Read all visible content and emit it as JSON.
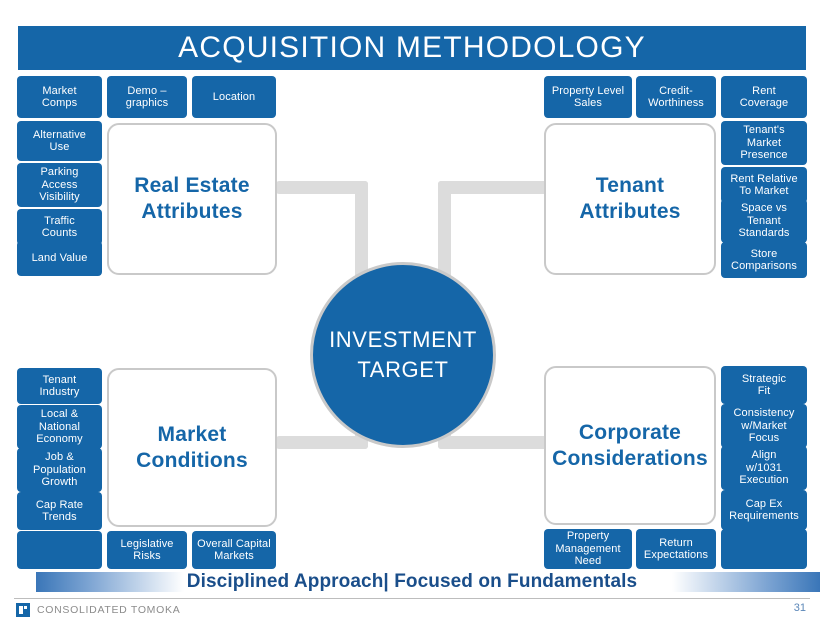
{
  "slide": {
    "title": "ACQUISITION METHODOLOGY",
    "tagline": "Disciplined Approach|  Focused on Fundamentals",
    "page_number": "31",
    "center": {
      "line1": "INVESTMENT",
      "line2": "TARGET"
    }
  },
  "colors": {
    "brand_blue": "#1566A8",
    "hub_border": "#c9c9c9",
    "connector_gray": "#dcdcdc",
    "tagline_blue": "#1A4E8A",
    "footer_gray": "#8c8c8c"
  },
  "quadrants": {
    "real_estate": {
      "hub_line1": "Real Estate",
      "hub_line2": "Attributes",
      "top_chips": [
        {
          "line1": "Market",
          "line2": "Comps"
        },
        {
          "line1": "Demo –",
          "line2": "graphics"
        },
        {
          "line1": "Location",
          "line2": ""
        }
      ],
      "side_chips": [
        {
          "line1": "Alternative",
          "line2": "Use",
          "line3": ""
        },
        {
          "line1": "Parking",
          "line2": "Access",
          "line3": "Visibility"
        },
        {
          "line1": "Traffic",
          "line2": "Counts",
          "line3": ""
        },
        {
          "line1": "Land Value",
          "line2": "",
          "line3": ""
        }
      ]
    },
    "tenant": {
      "hub_line1": "Tenant",
      "hub_line2": "Attributes",
      "top_chips": [
        {
          "line1": "Property Level",
          "line2": "Sales"
        },
        {
          "line1": "Credit-",
          "line2": "Worthiness"
        },
        {
          "line1": "Rent",
          "line2": "Coverage"
        }
      ],
      "side_chips": [
        {
          "line1": "Tenant's",
          "line2": "Market",
          "line3": "Presence"
        },
        {
          "line1": "Rent Relative",
          "line2": "To Market",
          "line3": ""
        },
        {
          "line1": "Space vs",
          "line2": "Tenant",
          "line3": "Standards"
        },
        {
          "line1": "Store",
          "line2": "Comparisons",
          "line3": ""
        }
      ]
    },
    "market": {
      "hub_line1": "Market",
      "hub_line2": "Conditions",
      "side_chips": [
        {
          "line1": "Tenant",
          "line2": "Industry",
          "line3": ""
        },
        {
          "line1": "Local &",
          "line2": "National",
          "line3": "Economy"
        },
        {
          "line1": "Job &",
          "line2": "Population",
          "line3": "Growth"
        },
        {
          "line1": "Cap Rate",
          "line2": "Trends",
          "line3": ""
        }
      ],
      "bottom_chips": [
        {
          "line1": "",
          "line2": ""
        },
        {
          "line1": "Legislative",
          "line2": "Risks"
        },
        {
          "line1": "Overall Capital",
          "line2": "Markets"
        }
      ]
    },
    "corporate": {
      "hub_line1": "Corporate",
      "hub_line2": "Considerations",
      "side_chips": [
        {
          "line1": "Strategic",
          "line2": "Fit",
          "line3": ""
        },
        {
          "line1": "Consistency",
          "line2": "w/Market",
          "line3": "Focus"
        },
        {
          "line1": "Align",
          "line2": "w/1031",
          "line3": "Execution"
        },
        {
          "line1": "Cap Ex",
          "line2": "Requirements",
          "line3": ""
        }
      ],
      "bottom_chips": [
        {
          "line1": "Property",
          "line2": "Management",
          "line3": "Need"
        },
        {
          "line1": "Return",
          "line2": "Expectations",
          "line3": ""
        },
        {
          "line1": "",
          "line2": "",
          "line3": ""
        }
      ]
    }
  },
  "footer": {
    "company": "CONSOLIDATED TOMOKA"
  }
}
